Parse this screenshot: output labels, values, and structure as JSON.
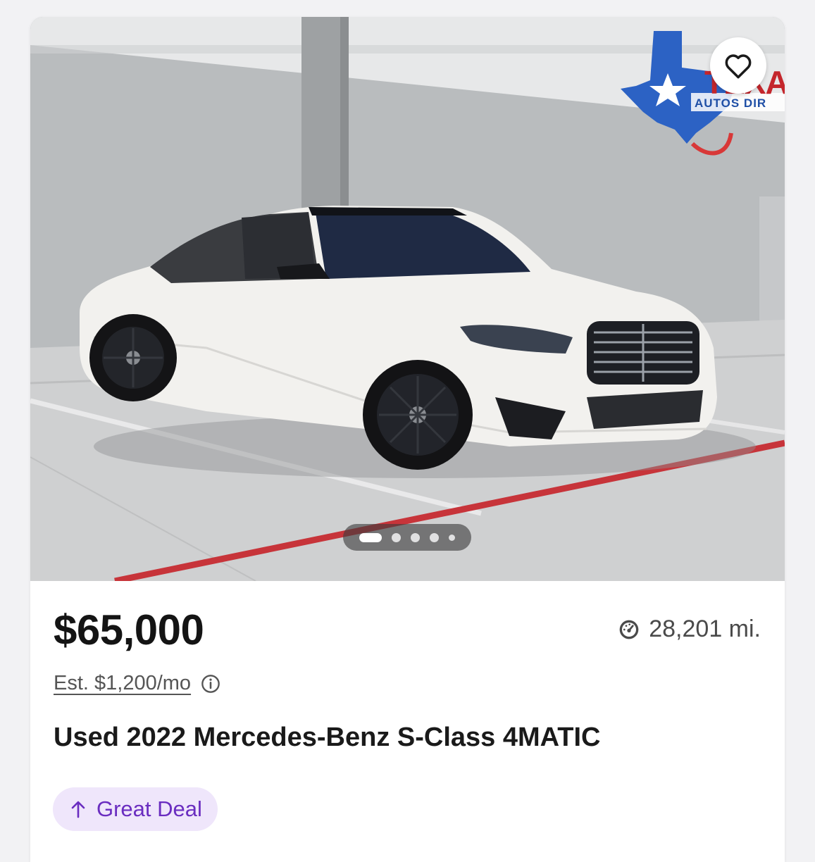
{
  "listing": {
    "price": "$65,000",
    "mileage": "28,201 mi.",
    "est_payment": "Est. $1,200/mo",
    "title": "Used 2022 Mercedes-Benz S-Class 4MATIC",
    "deal_badge": "Great Deal",
    "dealer_logo_text": "TEXA",
    "dealer_logo_subtext": "AUTOS DIR"
  },
  "carousel": {
    "total_images": 5,
    "active_index": 0
  },
  "icons": {
    "favorite": "heart-icon",
    "mileage": "speedometer-icon",
    "info": "info-icon",
    "deal": "arrow-up-icon"
  },
  "colors": {
    "deal_badge_bg": "#efe6fb",
    "deal_badge_text": "#6a2dc0",
    "price_text": "#141414"
  }
}
